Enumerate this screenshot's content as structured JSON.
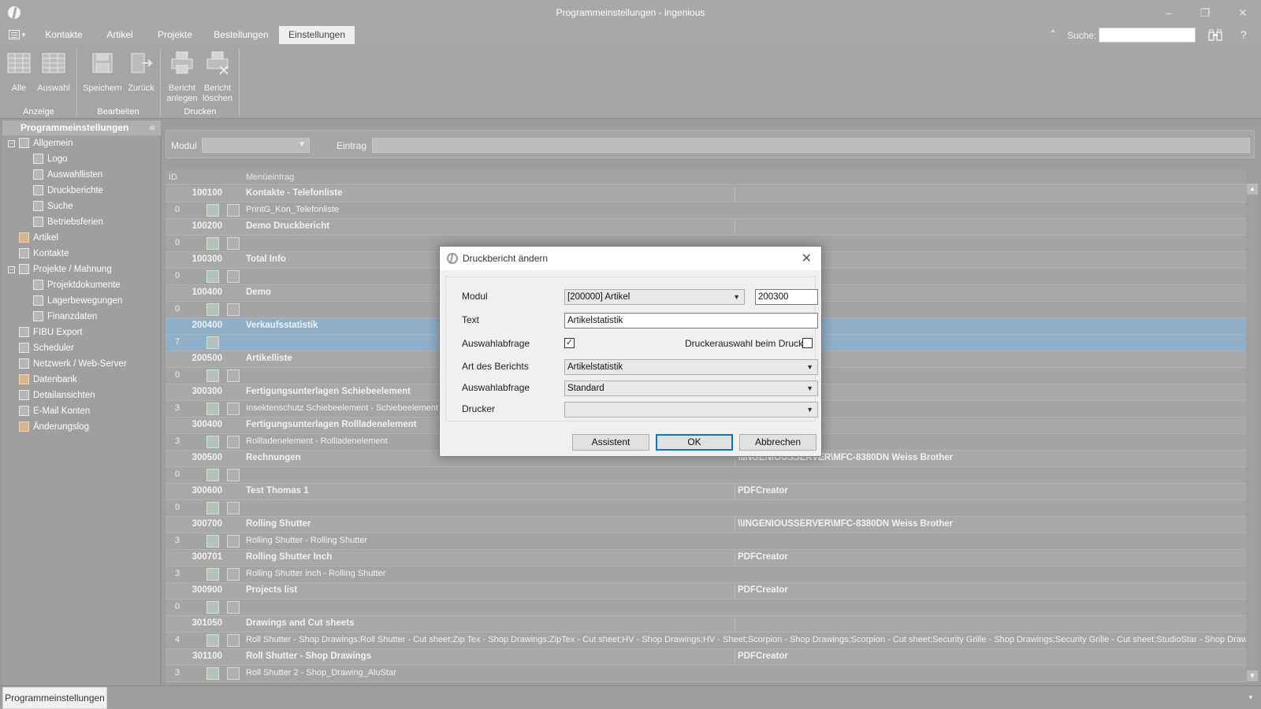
{
  "window": {
    "title": "Programmeinstellungen - ingenious"
  },
  "tabs": [
    {
      "label": "Kontakte"
    },
    {
      "label": "Artikel"
    },
    {
      "label": "Projekte"
    },
    {
      "label": "Bestellungen"
    },
    {
      "label": "Einstellungen",
      "active": true
    }
  ],
  "search": {
    "label": "Suche:",
    "value": ""
  },
  "ribbon": {
    "buttons": {
      "alle": "Alle",
      "auswahl": "Auswahl",
      "speichern": "Speichern",
      "zurueck": "Zurück",
      "bericht_anlegen_1": "Bericht",
      "bericht_anlegen_2": "anlegen",
      "bericht_loeschen_1": "Bericht",
      "bericht_loeschen_2": "löschen"
    },
    "groups": {
      "anzeige": "Anzeige",
      "bearbeiten": "Bearbeiten",
      "drucken": "Drucken"
    }
  },
  "sidebar": {
    "title": "Programmeinstellungen",
    "items": [
      {
        "label": "Allgemein"
      },
      {
        "label": "Logo"
      },
      {
        "label": "Auswahllisten"
      },
      {
        "label": "Druckberichte"
      },
      {
        "label": "Suche"
      },
      {
        "label": "Betriebsferien"
      },
      {
        "label": "Artikel"
      },
      {
        "label": "Kontakte"
      },
      {
        "label": "Projekte / Mahnung"
      },
      {
        "label": "Projektdokumente"
      },
      {
        "label": "Lagerbewegungen"
      },
      {
        "label": "Finanzdaten"
      },
      {
        "label": "FIBU Export"
      },
      {
        "label": "Scheduler"
      },
      {
        "label": "Netzwerk / Web-Server"
      },
      {
        "label": "Datenbank"
      },
      {
        "label": "Detailansichten"
      },
      {
        "label": "E-Mail Konten"
      },
      {
        "label": "Änderungslog"
      }
    ]
  },
  "filter": {
    "modul_label": "Modul",
    "eintrag_label": "Eintrag"
  },
  "grid": {
    "columns": {
      "id": "ID",
      "menu": "Menüeintrag"
    },
    "rows": [
      {
        "id": "100100",
        "name": "Kontakte - Telefonliste",
        "printer": ""
      },
      {
        "cnt": "0",
        "name": "PrintG_Kon_Telefonliste"
      },
      {
        "id": "100200",
        "name": "Demo Druckbericht",
        "printer": ""
      },
      {
        "cnt": "0",
        "name": ""
      },
      {
        "id": "100300",
        "name": "Total Info",
        "printer": ""
      },
      {
        "cnt": "0",
        "name": ""
      },
      {
        "id": "100400",
        "name": "Demo",
        "printer": ""
      },
      {
        "cnt": "0",
        "name": ""
      },
      {
        "id": "200400",
        "name": "Verkaufsstatistik",
        "printer": "",
        "selected": true
      },
      {
        "cnt": "7",
        "name": "",
        "selected": true
      },
      {
        "id": "200500",
        "name": "Artikelliste",
        "printer": ""
      },
      {
        "cnt": "0",
        "name": ""
      },
      {
        "id": "300300",
        "name": "Fertigungsunterlagen Schiebeelement",
        "printer": ""
      },
      {
        "cnt": "3",
        "name": "Insektenschutz Schiebeelement - Schiebeelement"
      },
      {
        "id": "300400",
        "name": "Fertigungsunterlagen Rollladenelement",
        "printer": ""
      },
      {
        "cnt": "3",
        "name": "Rollladenelement - Rollladenelement"
      },
      {
        "id": "300500",
        "name": "Rechnungen",
        "printer": "\\\\INGENIOUSSERVER\\MFC-8380DN Weiss Brother"
      },
      {
        "cnt": "0",
        "name": ""
      },
      {
        "id": "300600",
        "name": "Test Thomas 1",
        "printer": "PDFCreator"
      },
      {
        "cnt": "0",
        "name": ""
      },
      {
        "id": "300700",
        "name": "Rolling Shutter",
        "printer": "\\\\INGENIOUSSERVER\\MFC-8380DN Weiss Brother"
      },
      {
        "cnt": "3",
        "name": "Rolling Shutter - Rolling Shutter"
      },
      {
        "id": "300701",
        "name": "Rolling Shutter Inch",
        "printer": "PDFCreator"
      },
      {
        "cnt": "3",
        "name": "Rolling Shutter inch - Rolling Shutter"
      },
      {
        "id": "300900",
        "name": "Projects list",
        "printer": "PDFCreator"
      },
      {
        "cnt": "0",
        "name": ""
      },
      {
        "id": "301050",
        "name": "Drawings and Cut sheets",
        "printer": ""
      },
      {
        "cnt": "4",
        "name": "Roll Shutter - Shop Drawings;Roll Shutter - Cut sheet;Zip Tex - Shop Drawings;ZipTex - Cut sheet;HV - Shop Drawings;HV - Sheet;Scorpion - Shop Drawings;Scorpion - Cut sheet;Security Grille - Shop Drawings;Security Grille - Cut sheet;StudioStar - Shop Drawings"
      },
      {
        "id": "301100",
        "name": "Roll Shutter - Shop Drawings",
        "printer": "PDFCreator"
      },
      {
        "cnt": "3",
        "name": "Roll Shutter 2 - Shop_Drawing_AluStar"
      }
    ]
  },
  "bottom_tab": {
    "label": "Programmeinstellungen"
  },
  "dialog": {
    "title": "Druckbericht ändern",
    "modul_label": "Modul",
    "modul_value": "[200000] Artikel",
    "id_value": "200300",
    "text_label": "Text",
    "text_value": "Artikelstatistik",
    "auswahlabfrage_label": "Auswahlabfrage",
    "auswahlabfrage_checked": true,
    "druckerauswahl_label": "Druckerauswahl beim Druck",
    "druckerauswahl_checked": false,
    "art_label": "Art des Berichts",
    "art_value": "Artikelstatistik",
    "auswahlabfrage2_label": "Auswahlabfrage",
    "auswahlabfrage2_value": "Standard",
    "drucker_label": "Drucker",
    "drucker_value": "",
    "btn_assistent": "Assistent",
    "btn_ok": "OK",
    "btn_abbrechen": "Abbrechen"
  }
}
